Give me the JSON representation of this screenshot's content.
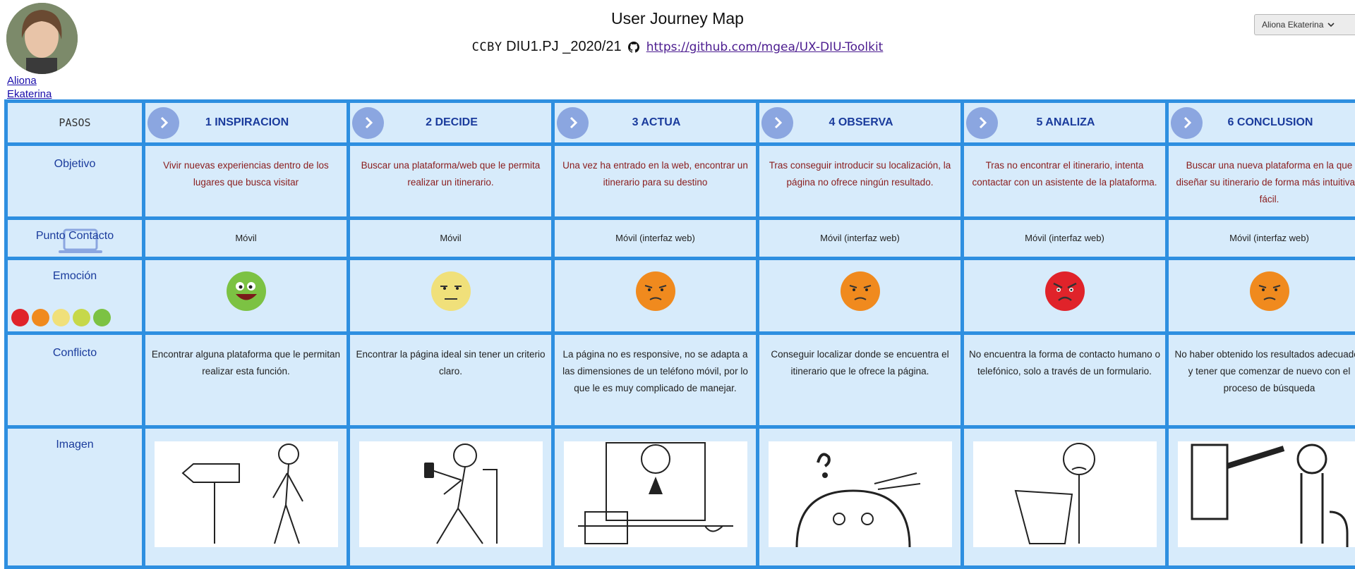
{
  "header": {
    "title": "User Journey Map",
    "cc": "CCBY",
    "project": "DIU1.PJ _2020/21",
    "link": "https://github.com/mgea/UX-DIU-Toolkit"
  },
  "author": {
    "name": "Aliona Ekaterina"
  },
  "user_select": {
    "value": "Aliona Ekaterina"
  },
  "rows": {
    "steps": "PASOS",
    "objective": "Objetivo",
    "touchpoint": "Punto Contacto",
    "emotion": "Emoción",
    "conflict": "Conflicto",
    "image": "Imagen"
  },
  "steps": [
    {
      "name": "1 INSPIRACION",
      "objective": "Vivir nuevas experiencias dentro de los lugares que busca visitar",
      "touchpoint": "Móvil",
      "emotion": "happy",
      "conflict": "Encontrar alguna plataforma que le permitan realizar esta función."
    },
    {
      "name": "2 DECIDE",
      "objective": "Buscar una plataforma/web que le permita realizar un itinerario.",
      "touchpoint": "Móvil",
      "emotion": "neutral",
      "conflict": "Encontrar la página ideal sin tener un criterio claro."
    },
    {
      "name": "3 ACTUA",
      "objective": "Una vez ha entrado en la web, encontrar un itinerario para su destino",
      "touchpoint": "Móvil (interfaz web)",
      "emotion": "annoyed",
      "conflict": "La página no es responsive, no se adapta a las dimensiones de un teléfono móvil, por lo que le es muy complicado de manejar."
    },
    {
      "name": "4 OBSERVA",
      "objective": "Tras conseguir introducir su localización, la página no ofrece ningún resultado.",
      "touchpoint": "Móvil (interfaz web)",
      "emotion": "annoyed",
      "conflict": "Conseguir localizar donde se encuentra el itinerario que le ofrece la página."
    },
    {
      "name": "5 ANALIZA",
      "objective": "Tras no encontrar el itinerario, intenta contactar con un asistente de la plataforma.",
      "touchpoint": "Móvil (interfaz web)",
      "emotion": "angry",
      "conflict": "No encuentra la forma de contacto humano o telefónico, solo a través de un formulario."
    },
    {
      "name": "6 CONCLUSION",
      "objective": "Buscar una nueva plataforma en la que diseñar su itinerario de forma más intuitiva y fácil.",
      "touchpoint": "Móvil (interfaz web)",
      "emotion": "annoyed",
      "conflict": "No haber obtenido los resultados adecuados y tener que comenzar de nuevo con el proceso de búsqueda"
    }
  ],
  "colors": {
    "grid": "#2e8fe0",
    "cell": "#d7ebfb",
    "happy": "#7cc243",
    "neutral": "#f0e07a",
    "annoyed": "#f08a1e",
    "angry": "#e0232a"
  }
}
